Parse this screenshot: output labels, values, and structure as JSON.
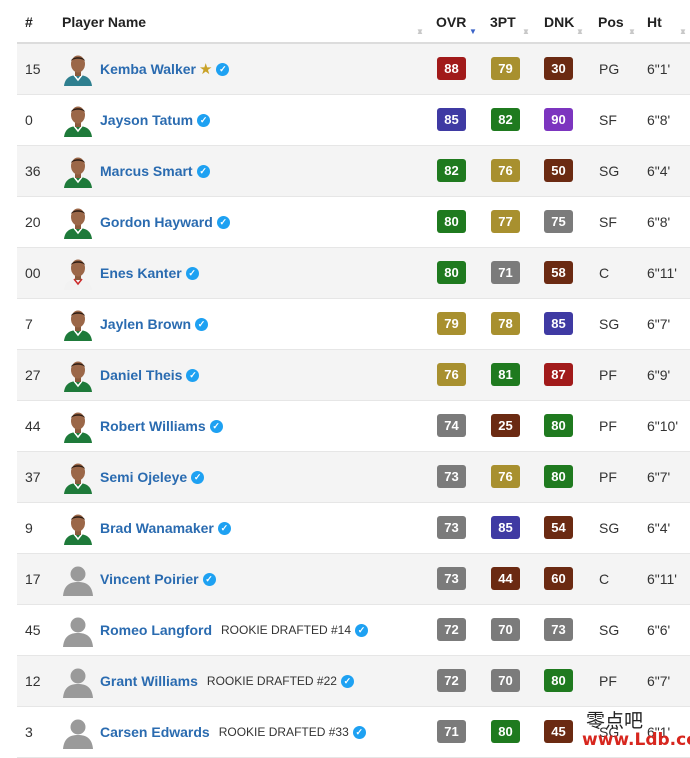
{
  "header": {
    "num": "#",
    "name": "Player Name",
    "ovr": "OVR",
    "tpt": "3PT",
    "dnk": "DNK",
    "pos": "Pos",
    "ht": "Ht"
  },
  "colors": {
    "olive": "#9a8a2a",
    "gold": "#b39a3a",
    "green": "#1f7a1f",
    "darkgreen": "#1e7f28",
    "blue": "#3f3aa3",
    "purple": "#7c35bf",
    "maroon": "#6b2a12",
    "red": "#a11a1a",
    "gray": "#7b7b7b",
    "verified": "#1ea1f2",
    "link": "#2a6bb0"
  },
  "players": [
    {
      "num": "15",
      "name": "Kemba Walker",
      "star": true,
      "rookie": "",
      "avatar": "photo-hornets",
      "ovr": "88",
      "ovr_color": "#a11a1a",
      "tpt": "79",
      "tpt_color": "#a8902f",
      "dnk": "30",
      "dnk_color": "#6b2a12",
      "pos": "PG",
      "ht": "6\"1'"
    },
    {
      "num": "0",
      "name": "Jayson Tatum",
      "star": false,
      "rookie": "",
      "avatar": "photo-celtics",
      "ovr": "85",
      "ovr_color": "#3f3aa3",
      "tpt": "82",
      "tpt_color": "#1f7a1f",
      "dnk": "90",
      "dnk_color": "#7c35bf",
      "pos": "SF",
      "ht": "6\"8'"
    },
    {
      "num": "36",
      "name": "Marcus Smart",
      "star": false,
      "rookie": "",
      "avatar": "photo-celtics",
      "ovr": "82",
      "ovr_color": "#1f7a1f",
      "tpt": "76",
      "tpt_color": "#a8902f",
      "dnk": "50",
      "dnk_color": "#6b2a12",
      "pos": "SG",
      "ht": "6\"4'"
    },
    {
      "num": "20",
      "name": "Gordon Hayward",
      "star": false,
      "rookie": "",
      "avatar": "photo-celtics",
      "ovr": "80",
      "ovr_color": "#1f7a1f",
      "tpt": "77",
      "tpt_color": "#a8902f",
      "dnk": "75",
      "dnk_color": "#7b7b7b",
      "pos": "SF",
      "ht": "6\"8'"
    },
    {
      "num": "00",
      "name": "Enes Kanter",
      "star": false,
      "rookie": "",
      "avatar": "photo-blazers",
      "ovr": "80",
      "ovr_color": "#1f7a1f",
      "tpt": "71",
      "tpt_color": "#7b7b7b",
      "dnk": "58",
      "dnk_color": "#6b2a12",
      "pos": "C",
      "ht": "6\"11'"
    },
    {
      "num": "7",
      "name": "Jaylen Brown",
      "star": false,
      "rookie": "",
      "avatar": "photo-celtics",
      "ovr": "79",
      "ovr_color": "#a8902f",
      "tpt": "78",
      "tpt_color": "#a8902f",
      "dnk": "85",
      "dnk_color": "#3f3aa3",
      "pos": "SG",
      "ht": "6\"7'"
    },
    {
      "num": "27",
      "name": "Daniel Theis",
      "star": false,
      "rookie": "",
      "avatar": "photo-celtics",
      "ovr": "76",
      "ovr_color": "#a8902f",
      "tpt": "81",
      "tpt_color": "#1f7a1f",
      "dnk": "87",
      "dnk_color": "#a11a1a",
      "pos": "PF",
      "ht": "6\"9'"
    },
    {
      "num": "44",
      "name": "Robert Williams",
      "star": false,
      "rookie": "",
      "avatar": "photo-celtics",
      "ovr": "74",
      "ovr_color": "#7b7b7b",
      "tpt": "25",
      "tpt_color": "#6b2a12",
      "dnk": "80",
      "dnk_color": "#1f7a1f",
      "pos": "PF",
      "ht": "6\"10'"
    },
    {
      "num": "37",
      "name": "Semi Ojeleye",
      "star": false,
      "rookie": "",
      "avatar": "photo-celtics",
      "ovr": "73",
      "ovr_color": "#7b7b7b",
      "tpt": "76",
      "tpt_color": "#a8902f",
      "dnk": "80",
      "dnk_color": "#1f7a1f",
      "pos": "PF",
      "ht": "6\"7'"
    },
    {
      "num": "9",
      "name": "Brad Wanamaker",
      "star": false,
      "rookie": "",
      "avatar": "photo-celtics",
      "ovr": "73",
      "ovr_color": "#7b7b7b",
      "tpt": "85",
      "tpt_color": "#3f3aa3",
      "dnk": "54",
      "dnk_color": "#6b2a12",
      "pos": "SG",
      "ht": "6\"4'"
    },
    {
      "num": "17",
      "name": "Vincent Poirier",
      "star": false,
      "rookie": "",
      "avatar": "silhouette",
      "ovr": "73",
      "ovr_color": "#7b7b7b",
      "tpt": "44",
      "tpt_color": "#6b2a12",
      "dnk": "60",
      "dnk_color": "#6b2a12",
      "pos": "C",
      "ht": "6\"11'"
    },
    {
      "num": "45",
      "name": "Romeo Langford",
      "star": false,
      "rookie": "ROOKIE DRAFTED #14",
      "avatar": "silhouette",
      "ovr": "72",
      "ovr_color": "#7b7b7b",
      "tpt": "70",
      "tpt_color": "#7b7b7b",
      "dnk": "73",
      "dnk_color": "#7b7b7b",
      "pos": "SG",
      "ht": "6\"6'"
    },
    {
      "num": "12",
      "name": "Grant Williams",
      "star": false,
      "rookie": "ROOKIE DRAFTED #22",
      "avatar": "silhouette",
      "ovr": "72",
      "ovr_color": "#7b7b7b",
      "tpt": "70",
      "tpt_color": "#7b7b7b",
      "dnk": "80",
      "dnk_color": "#1f7a1f",
      "pos": "PF",
      "ht": "6\"7'"
    },
    {
      "num": "3",
      "name": "Carsen Edwards",
      "star": false,
      "rookie": "ROOKIE DRAFTED #33",
      "avatar": "silhouette",
      "ovr": "71",
      "ovr_color": "#7b7b7b",
      "tpt": "80",
      "tpt_color": "#1f7a1f",
      "dnk": "45",
      "dnk_color": "#6b2a12",
      "pos": "SG",
      "ht": "6\"1'"
    }
  ],
  "watermark": {
    "line1": "零点吧",
    "line2": "www.Ldb.cc"
  }
}
